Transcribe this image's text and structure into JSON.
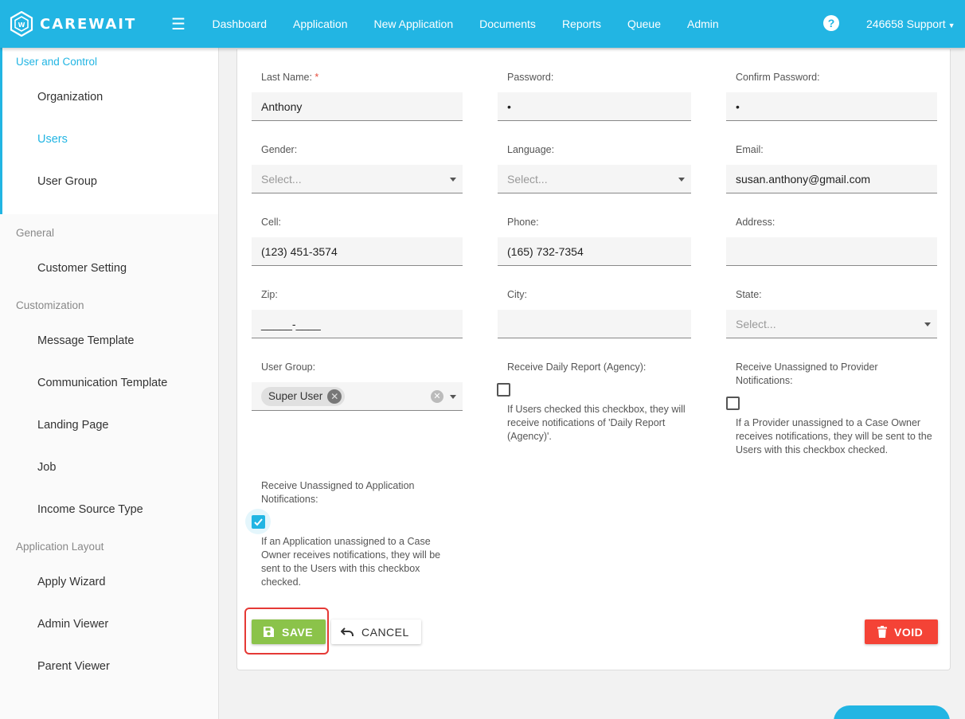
{
  "header": {
    "brand": "CAREWAIT",
    "nav": [
      "Dashboard",
      "Application",
      "New Application",
      "Documents",
      "Reports",
      "Queue",
      "Admin"
    ],
    "help": "?",
    "user": "246658 Support"
  },
  "sidebar": {
    "active_section": {
      "title": "User and Control",
      "items": [
        "Organization",
        "Users",
        "User Group"
      ],
      "active_item": "Users"
    },
    "sections": [
      {
        "title": "General",
        "items": [
          "Customer Setting"
        ]
      },
      {
        "title": "Customization",
        "items": [
          "Message Template",
          "Communication Template",
          "Landing Page",
          "Job",
          "Income Source Type"
        ]
      },
      {
        "title": "Application Layout",
        "items": [
          "Apply Wizard",
          "Admin Viewer",
          "Parent Viewer"
        ]
      }
    ]
  },
  "form": {
    "last_name": {
      "label": "Last Name:",
      "required": "*",
      "value": "Anthony"
    },
    "password": {
      "label": "Password:",
      "value": "•"
    },
    "confirm_password": {
      "label": "Confirm Password:",
      "value": "•"
    },
    "gender": {
      "label": "Gender:",
      "placeholder": "Select..."
    },
    "language": {
      "label": "Language:",
      "placeholder": "Select..."
    },
    "email": {
      "label": "Email:",
      "value": "susan.anthony@gmail.com"
    },
    "cell": {
      "label": "Cell:",
      "value": "(123) 451-3574"
    },
    "phone": {
      "label": "Phone:",
      "value": "(165) 732-7354"
    },
    "address": {
      "label": "Address:",
      "value": ""
    },
    "zip": {
      "label": "Zip:",
      "value": "_____-____"
    },
    "city": {
      "label": "City:",
      "value": ""
    },
    "state": {
      "label": "State:",
      "placeholder": "Select..."
    },
    "user_group": {
      "label": "User Group:",
      "chip": "Super User"
    },
    "daily_report": {
      "label": "Receive Daily Report (Agency):",
      "checked": false,
      "help": "If Users checked this checkbox, they will receive notifications of 'Daily Report (Agency)'."
    },
    "unassigned_provider": {
      "label": "Receive Unassigned to Provider Notifications:",
      "checked": false,
      "help": "If a Provider unassigned to a Case Owner receives notifications, they will be sent to the Users with this checkbox checked."
    },
    "unassigned_application": {
      "label": "Receive Unassigned to Application Notifications:",
      "checked": true,
      "help": "If an Application unassigned to a Case Owner receives notifications, they will be sent to the Users with this checkbox checked."
    }
  },
  "actions": {
    "save": "SAVE",
    "cancel": "CANCEL",
    "void": "VOID"
  },
  "colors": {
    "primary": "#22b5e3",
    "save": "#8bc34a",
    "void": "#f44336",
    "highlight": "#e53935"
  },
  "icons": {
    "save": "floppy-disk-icon",
    "cancel": "undo-icon",
    "void": "trash-icon",
    "help": "question-circle-icon",
    "menu": "hamburger-icon"
  }
}
